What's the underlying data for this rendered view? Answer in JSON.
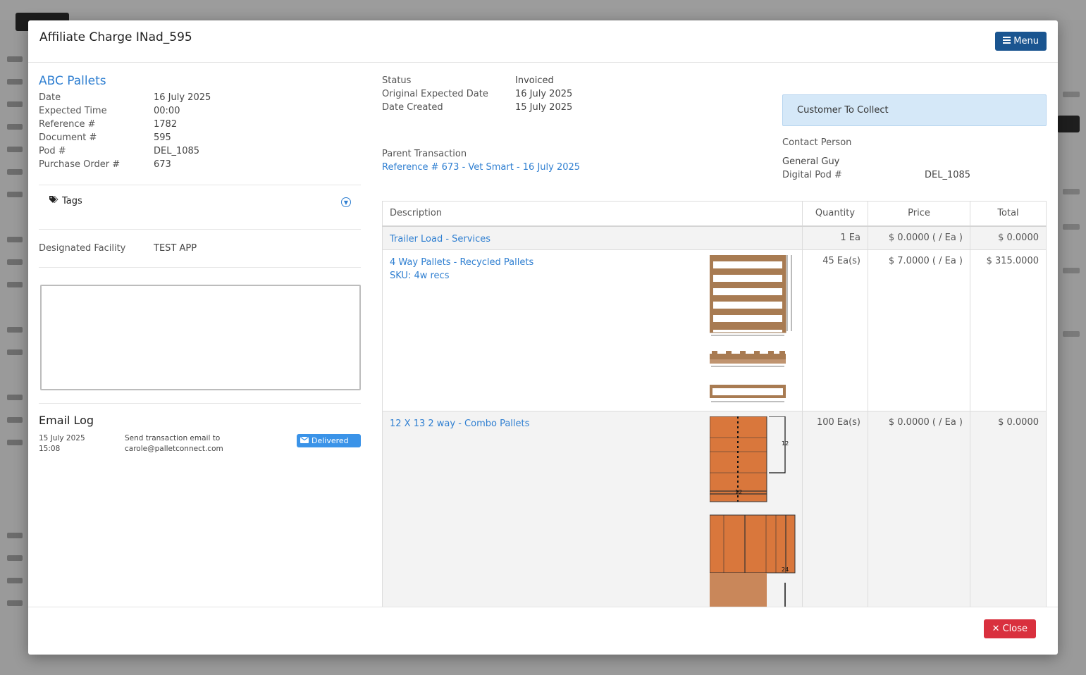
{
  "modal": {
    "title": "Affiliate Charge INad_595",
    "menu_label": "Menu",
    "close_label": "Close"
  },
  "summary": {
    "company": "ABC Pallets",
    "fields": [
      {
        "label": "Date",
        "value": "16 July 2025"
      },
      {
        "label": "Expected Time",
        "value": "00:00"
      },
      {
        "label": "Reference #",
        "value": "1782"
      },
      {
        "label": "Document #",
        "value": "595"
      },
      {
        "label": "Pod #",
        "value": "DEL_1085"
      },
      {
        "label": "Purchase Order #",
        "value": "673"
      }
    ],
    "tags_label": "Tags",
    "facility_label": "Designated Facility",
    "facility_value": "TEST APP"
  },
  "email_log": {
    "title": "Email Log",
    "entries": [
      {
        "date": "15 July 2025",
        "time": "15:08",
        "message_line1": "Send transaction email to",
        "message_line2": "carole@palletconnect.com",
        "status": "Delivered"
      }
    ]
  },
  "status_info": {
    "fields": [
      {
        "label": "Status",
        "value": "Invoiced"
      },
      {
        "label": "Original Expected Date",
        "value": "16 July 2025"
      },
      {
        "label": "Date Created",
        "value": "15 July 2025"
      }
    ],
    "parent_label": "Parent Transaction",
    "parent_link": "Reference # 673 - Vet Smart - 16 July 2025"
  },
  "collection": {
    "callout": "Customer To Collect",
    "contact_label": "Contact Person",
    "contact_name": "General Guy",
    "digital_pod_label": "Digital Pod #",
    "digital_pod_value": "DEL_1085"
  },
  "items_table": {
    "headers": {
      "description": "Description",
      "quantity": "Quantity",
      "price": "Price",
      "total": "Total"
    },
    "rows": [
      {
        "name": "Trailer Load - Services",
        "sku": "",
        "quantity": "1 Ea",
        "price": "$ 0.0000 ( / Ea )",
        "total": "$ 0.0000"
      },
      {
        "name": "4 Way Pallets - Recycled Pallets",
        "sku": "SKU: 4w recs",
        "quantity": "45 Ea(s)",
        "price": "$ 7.0000 ( / Ea )",
        "total": "$ 315.0000"
      },
      {
        "name": "12 X 13 2 way - Combo Pallets",
        "sku": "",
        "quantity": "100 Ea(s)",
        "price": "$ 0.0000 ( / Ea )",
        "total": "$ 0.0000"
      }
    ],
    "drawing_labels": {
      "side": "12",
      "mark_a": "12",
      "mark_b": "24"
    }
  },
  "colors": {
    "primary_button": "#1a5590",
    "danger_button": "#d9303e",
    "link": "#2f7fd1",
    "callout_bg": "#d5e8f8",
    "delivered_badge": "#3a93e8"
  }
}
